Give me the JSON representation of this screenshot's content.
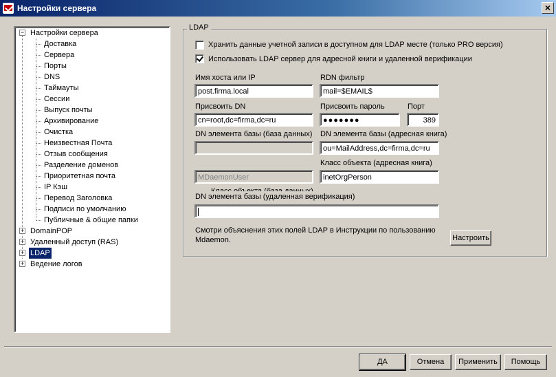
{
  "window": {
    "title": "Настройки сервера",
    "close": "×"
  },
  "tree": {
    "root": {
      "label": "Настройки сервера",
      "expander": "−"
    },
    "children": [
      "Доставка",
      "Сервера",
      "Порты",
      "DNS",
      "Таймауты",
      "Сессии",
      "Выпуск почты",
      "Архивирование",
      "Очистка",
      "Неизвестная Почта",
      "Отзыв сообщения",
      "Разделение доменов",
      "Приоритетная почта",
      "IP Кэш",
      "Перевод Заголовка",
      "Подписи по умолчанию",
      "Публичные & общие папки"
    ],
    "groups": [
      {
        "label": "DomainPOP",
        "expander": "+"
      },
      {
        "label": "Удаленный доступ (RAS)",
        "expander": "+"
      },
      {
        "label": "LDAP",
        "expander": "+",
        "selected": true
      },
      {
        "label": "Ведение логов",
        "expander": "+"
      }
    ]
  },
  "ldap": {
    "group_title": "LDAP",
    "checkbox_store": {
      "label": "Хранить данные учетной записи в доступном для LDAP месте (только PRO версия)",
      "checked": false
    },
    "checkbox_use": {
      "label": "Использовать LDAP сервер для адресной книги и удаленной верификации",
      "checked": true
    },
    "host": {
      "label": "Имя хоста или IP",
      "value": "post.firma.local"
    },
    "rdn": {
      "label": "RDN фильтр",
      "value": "mail=$EMAIL$"
    },
    "bind_dn": {
      "label": "Присвоить DN",
      "value": "cn=root,dc=firma,dc=ru"
    },
    "bind_pass": {
      "label": "Присвоить пароль",
      "value": "●●●●●●●"
    },
    "port": {
      "label": "Порт",
      "value": "389"
    },
    "base_dn_db": {
      "label": "DN элемента базы (база данных)",
      "value": ""
    },
    "base_dn_book": {
      "label": "DN элемента базы (адресная книга)",
      "value": "ou=MailAddress,dc=firma,dc=ru"
    },
    "object_class_book": {
      "label": "Класс объекта (адресная книга)",
      "value": "inetOrgPerson"
    },
    "object_class_db": {
      "value": "MDaemonUser",
      "ghost_label": "Класс объекта (база данных)"
    },
    "base_dn_verify": {
      "label": "DN элемента базы (удаленная верификация)",
      "value": ""
    },
    "note": "Смотри объяснения этих полей LDAP в Инструкции по пользованию Mdaemon.",
    "configure_button": "Настроить"
  },
  "buttons": {
    "ok": "ДА",
    "cancel": "Отмена",
    "apply": "Применить",
    "help": "Помощь"
  }
}
